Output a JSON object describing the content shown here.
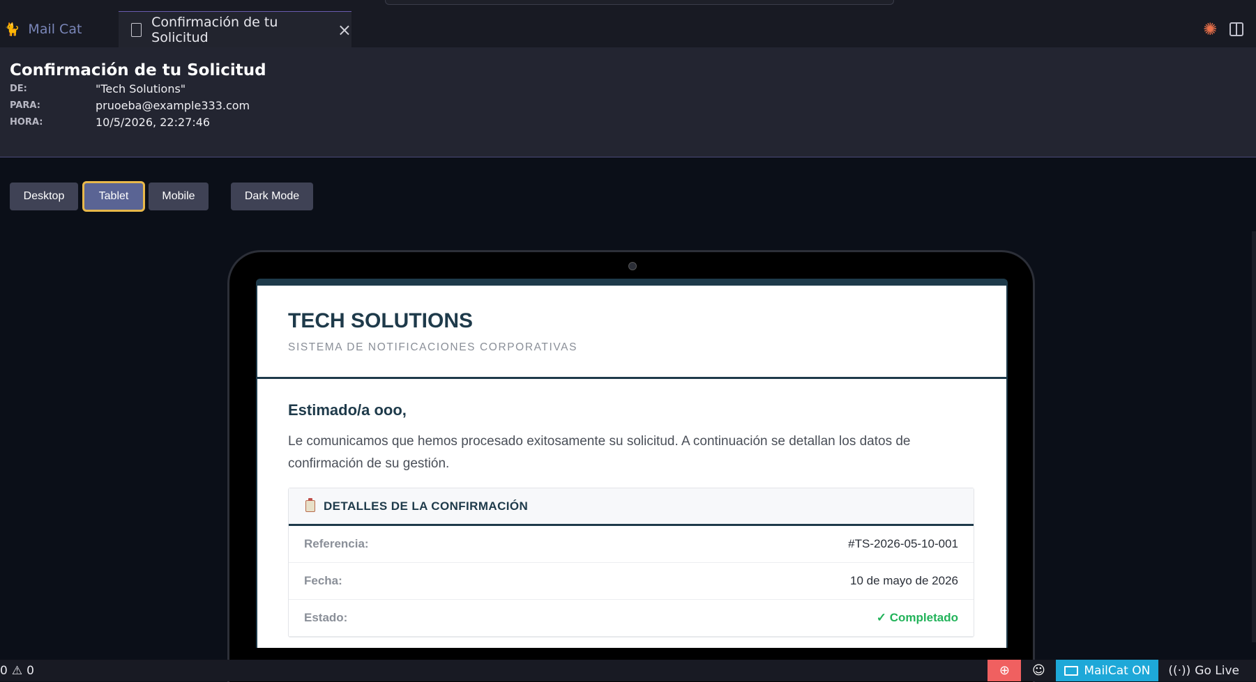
{
  "tabs": [
    {
      "label": "Mail Cat",
      "icon": "cat-icon"
    },
    {
      "label": "Confirmación de tu Solicitud",
      "icon": "file-icon"
    }
  ],
  "email": {
    "subject": "Confirmación de tu Solicitud",
    "from_label": "DE:",
    "from": "\"Tech Solutions\"",
    "to_label": "PARA:",
    "to": "pruoeba@example333.com",
    "time_label": "HORA:",
    "time": "10/5/2026, 22:27:46"
  },
  "view_buttons": {
    "desktop": "Desktop",
    "tablet": "Tablet",
    "mobile": "Mobile",
    "dark": "Dark Mode",
    "active": "tablet"
  },
  "content": {
    "brand": "TECH SOLUTIONS",
    "brand_sub": "SISTEMA DE NOTIFICACIONES CORPORATIVAS",
    "greeting": "Estimado/a ooo,",
    "intro": "Le comunicamos que hemos procesado exitosamente su solicitud. A continuación se detallan los datos de confirmación de su gestión.",
    "details_title": "DETALLES DE LA CONFIRMACIÓN",
    "rows": [
      {
        "label": "Referencia:",
        "value": "#TS-2026-05-10-001"
      },
      {
        "label": "Fecha:",
        "value": "10 de mayo de 2026"
      },
      {
        "label": "Estado:",
        "value": "✓ Completado"
      }
    ]
  },
  "statusbar": {
    "errors": "0",
    "warnings": "0",
    "mailcat": "MailCat ON",
    "golive": "Go Live"
  },
  "colors": {
    "accent": "#1e3a4a",
    "success": "#22b35a",
    "mailcat": "#1ea8d8",
    "active_outline": "#e8b84a"
  }
}
